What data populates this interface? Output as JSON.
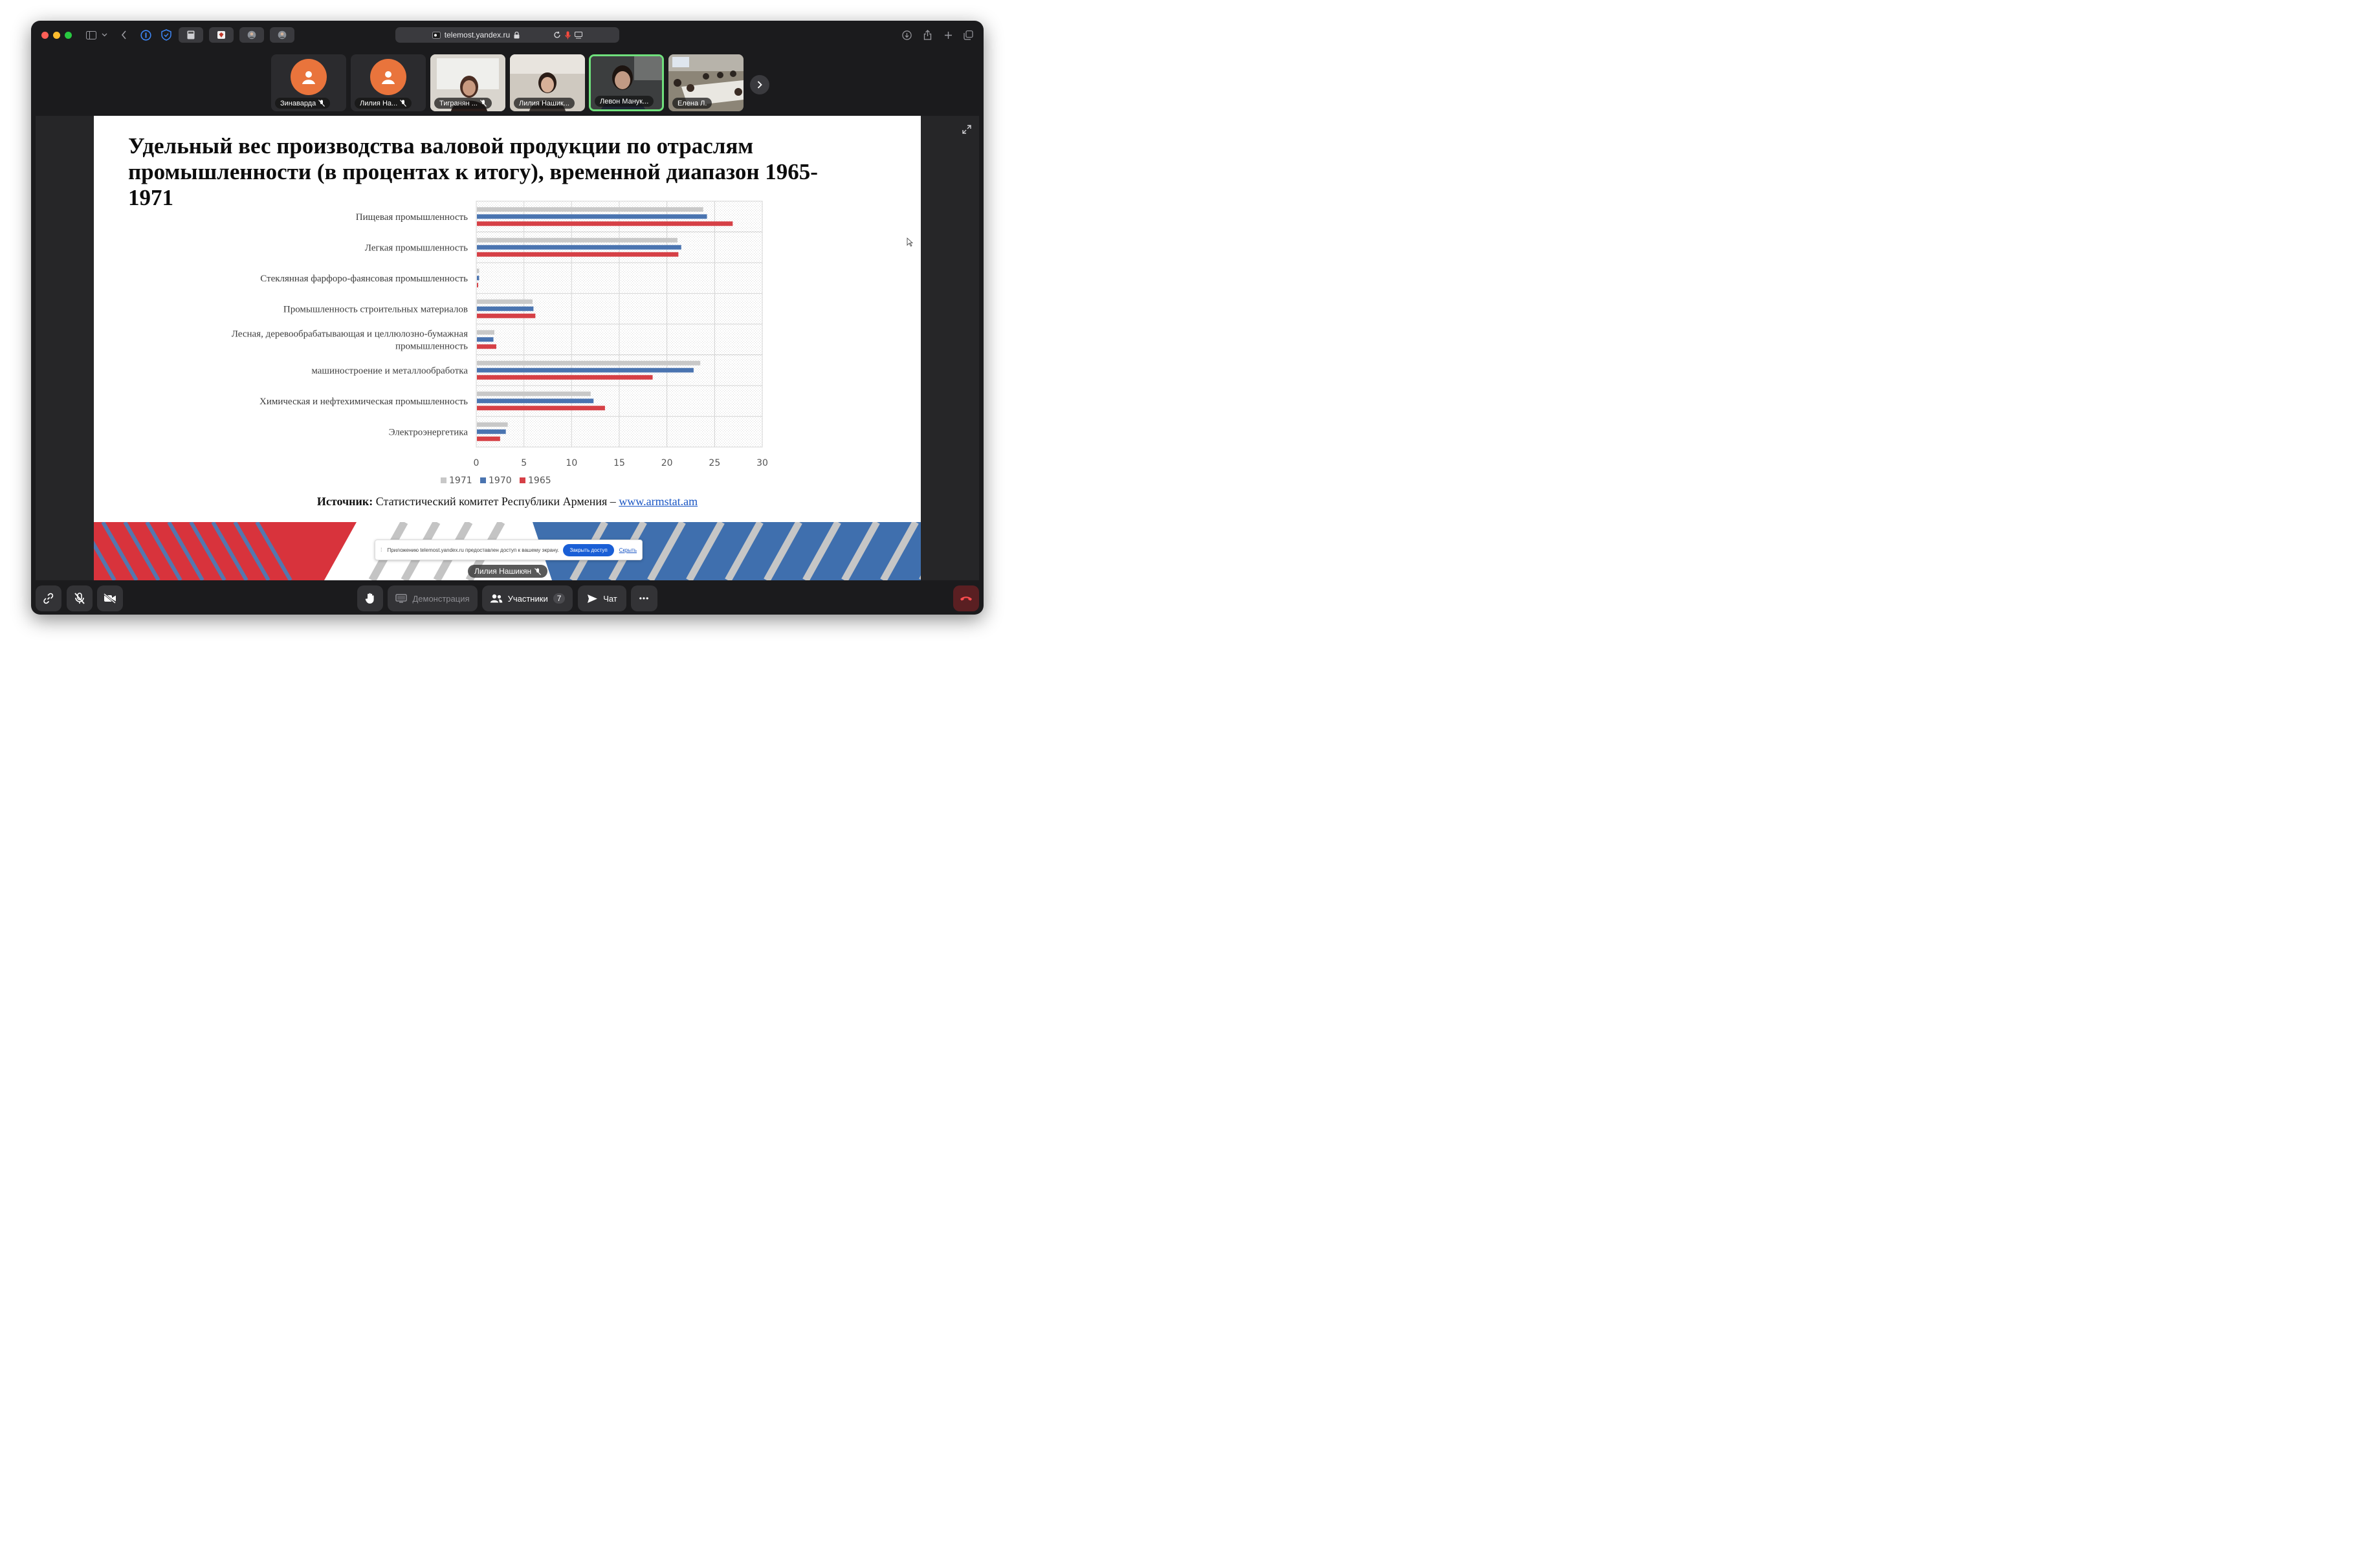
{
  "browser": {
    "url": "telemost.yandex.ru",
    "traffic_lights": [
      "#ff5f57",
      "#febc2e",
      "#28c840"
    ]
  },
  "participants": [
    {
      "name": "Зинаварда",
      "muted": true,
      "kind": "avatar"
    },
    {
      "name": "Лилия На...",
      "muted": true,
      "kind": "avatar"
    },
    {
      "name": "Тигранян ...",
      "muted": true,
      "kind": "video"
    },
    {
      "name": "Лилия Нашик...",
      "muted": false,
      "kind": "video"
    },
    {
      "name": "Левон Манук...",
      "muted": false,
      "kind": "video",
      "active": true
    },
    {
      "name": "Елена Л.",
      "muted": false,
      "kind": "video"
    }
  ],
  "slide": {
    "title": "Удельный вес производства валовой продукции по отраслям промышленности (в процентах к итогу), временной диапазон 1965-1971",
    "source_label": "Источник:",
    "source_text": " Статистический комитет Республики Армения – ",
    "source_link": "www.armstat.am"
  },
  "chart_data": {
    "type": "bar",
    "orientation": "horizontal",
    "categories": [
      "Пищевая промышленность",
      "Легкая промышленность",
      "Стеклянная фарфоро-фаянсовая промышленность",
      "Промышленность строительных материалов",
      "Лесная, деревообрабатывающая и целлюлозно-бумажная промышленность",
      "машиностроение и металлообработка",
      "Химическая и нефтехимическая промышленность",
      "Электроэнергетика"
    ],
    "category_labels": [
      [
        "Пищевая промышленность"
      ],
      [
        "Легкая промышленность"
      ],
      [
        "Стеклянная фарфоро-фаянсовая промышленность"
      ],
      [
        "Промышленность строительных материалов"
      ],
      [
        "Лесная, деревообрабатывающая и целлюлозно-бумажная",
        "промышленность"
      ],
      [
        "машиностроение и металлообработка"
      ],
      [
        "Химическая и нефтехимическая промышленность"
      ],
      [
        "Электроэнергетика"
      ]
    ],
    "series": [
      {
        "name": "1971",
        "color": "#c8c8c8",
        "values": [
          23.8,
          21.1,
          0.3,
          5.9,
          1.9,
          23.5,
          12.0,
          3.3
        ]
      },
      {
        "name": "1970",
        "color": "#4a74b0",
        "values": [
          24.2,
          21.5,
          0.3,
          6.0,
          1.8,
          22.8,
          12.3,
          3.1
        ]
      },
      {
        "name": "1965",
        "color": "#d64046",
        "values": [
          26.9,
          21.2,
          0.2,
          6.2,
          2.1,
          18.5,
          13.5,
          2.5
        ]
      }
    ],
    "xlim": [
      0,
      30
    ],
    "xticks": [
      "0",
      "5",
      "10",
      "15",
      "20",
      "25",
      "30"
    ],
    "grid": true,
    "legend_position": "bottom"
  },
  "share_notice": {
    "text": "Приложению telemost.yandex.ru предоставлен доступ к вашему экрану.",
    "stop_label": "Закрыть доступ",
    "hide_label": "Скрыть"
  },
  "speaker_label": "Лилия Нашикян",
  "controls": {
    "demo_label": "Демонстрация",
    "participants_label": "Участники",
    "participants_count": "7",
    "chat_label": "Чат",
    "more_label": "•••"
  }
}
